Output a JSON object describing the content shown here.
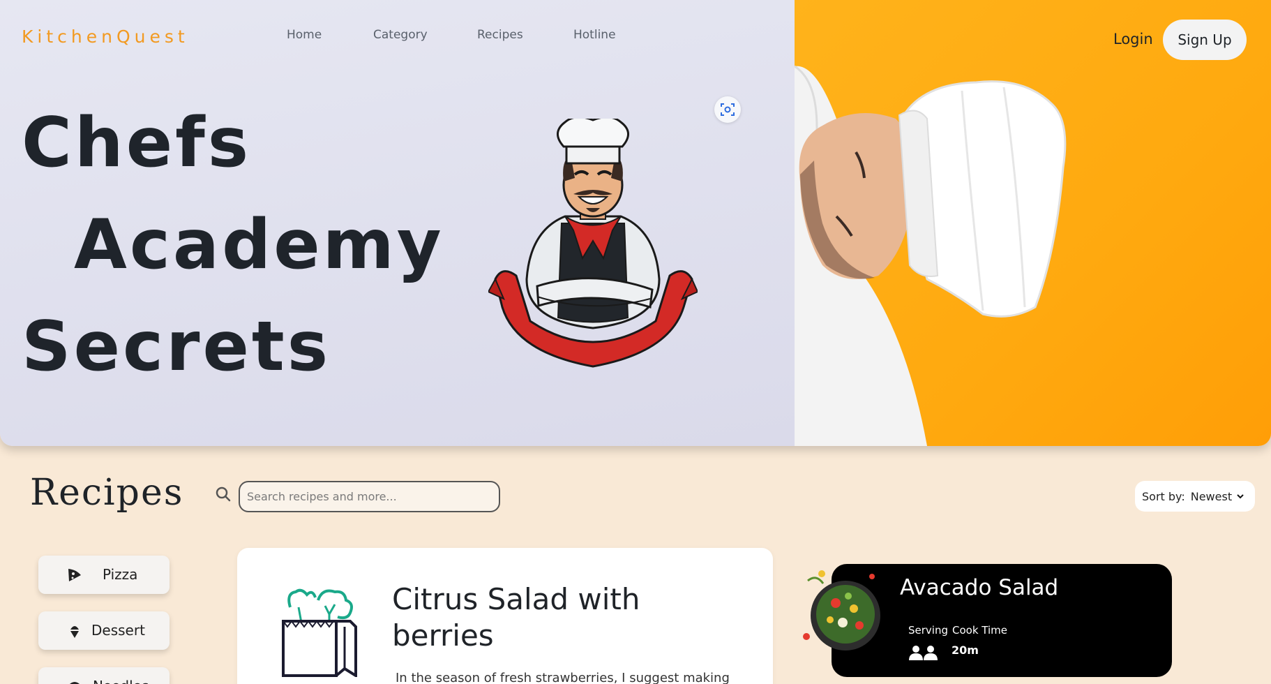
{
  "brand": {
    "name": "KitchenQuest",
    "color": "#f29a21"
  },
  "nav": {
    "items": [
      {
        "label": "Home"
      },
      {
        "label": "Category"
      },
      {
        "label": "Recipes"
      },
      {
        "label": "Hotline"
      }
    ]
  },
  "auth": {
    "login_label": "Login",
    "signup_label": "Sign Up"
  },
  "hero": {
    "title_lines": [
      "Chefs",
      "Academy",
      "Secrets"
    ],
    "scan_icon": "scan-icon",
    "accent_color": "#ffab12"
  },
  "recipes": {
    "heading": "Recipes",
    "search_placeholder": "Search recipes and more...",
    "sort_label": "Sort by:",
    "sort_value": "Newest"
  },
  "categories": [
    {
      "label": "Pizza",
      "icon": "pizza-icon"
    },
    {
      "label": "Dessert",
      "icon": "dessert-icon"
    },
    {
      "label": "Noodles",
      "icon": "noodles-icon"
    }
  ],
  "recipe_card": {
    "title": "Citrus Salad with berries",
    "description": "In the season of fresh strawberries, I suggest making",
    "icon": "grocery-bag-icon"
  },
  "featured": {
    "title": "Avacado Salad",
    "serving_label": "Serving",
    "cook_time_label": "Cook Time",
    "cook_time_value": "20m",
    "people_icon": "people-icon"
  }
}
